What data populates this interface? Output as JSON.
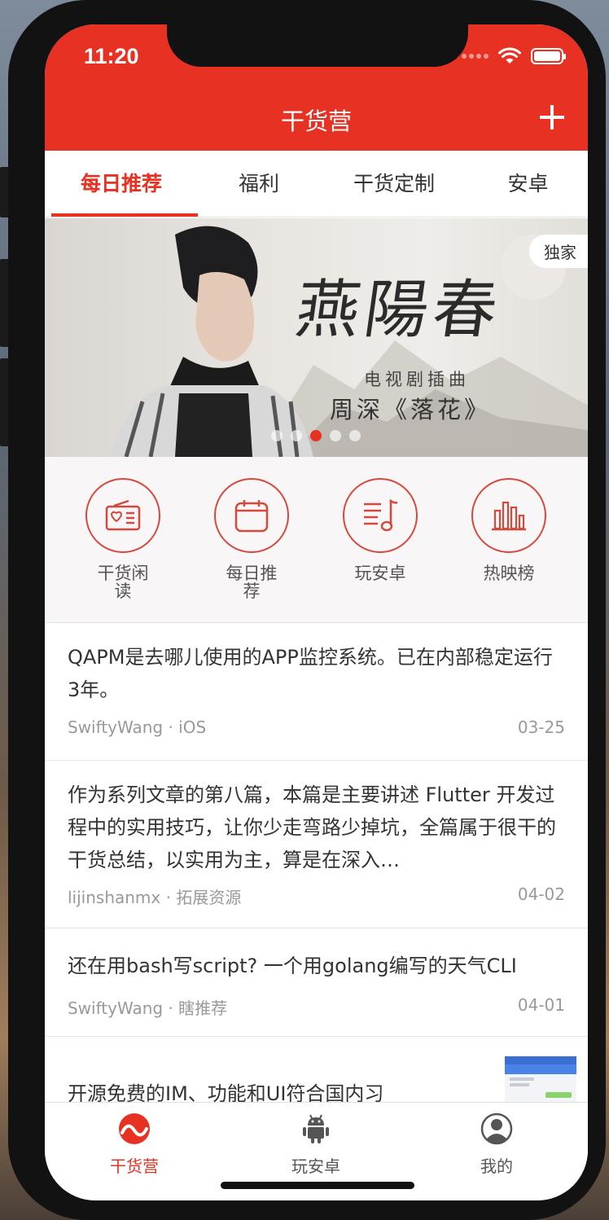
{
  "status": {
    "time": "11:20"
  },
  "nav": {
    "title": "干货营"
  },
  "tabs": [
    {
      "label": "每日推荐",
      "active": true
    },
    {
      "label": "福利",
      "active": false
    },
    {
      "label": "干货定制",
      "active": false
    },
    {
      "label": "安卓",
      "active": false
    }
  ],
  "banner": {
    "badge": "独家",
    "title": "燕陽春",
    "subtitle": "电视剧插曲",
    "caption": "周深《落花》",
    "dot_count": 5,
    "active_dot": 3
  },
  "quick_links": [
    {
      "label": "干货闲读",
      "icon": "radio-icon"
    },
    {
      "label": "每日推荐",
      "icon": "calendar-icon"
    },
    {
      "label": "玩安卓",
      "icon": "music-list-icon"
    },
    {
      "label": "热映榜",
      "icon": "bar-chart-icon"
    }
  ],
  "articles": [
    {
      "title": "QAPM是去哪儿使用的APP监控系统。已在内部稳定运行3年。",
      "meta": "SwiftyWang · iOS",
      "date": "03-25"
    },
    {
      "title": "作为系列文章的第八篇，本篇是主要讲述 Flutter 开发过程中的实用技巧，让你少走弯路少掉坑，全篇属于很干的干货总结，以实用为主，算是在深入…",
      "meta": "lijinshanmx · 拓展资源",
      "date": "04-02"
    },
    {
      "title": "还在用bash写script? 一个用golang编写的天气CLI",
      "meta": "SwiftyWang · 瞎推荐",
      "date": "04-01"
    },
    {
      "title": "开源免费的IM、功能和UI符合国内习",
      "meta": "",
      "date": ""
    }
  ],
  "tabbar": [
    {
      "label": "干货营",
      "icon": "wave-icon",
      "active": true
    },
    {
      "label": "玩安卓",
      "icon": "android-icon",
      "active": false
    },
    {
      "label": "我的",
      "icon": "user-icon",
      "active": false
    }
  ],
  "colors": {
    "accent": "#e73223",
    "text": "#333333",
    "muted": "#999999"
  }
}
